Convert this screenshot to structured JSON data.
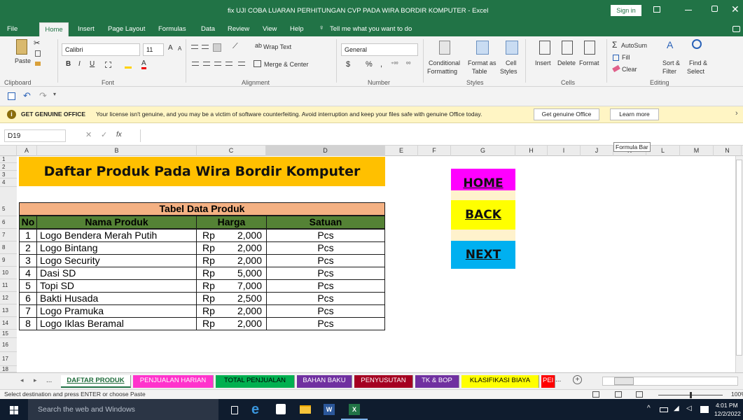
{
  "window": {
    "title": "fix UJI COBA LUARAN PERHITUNGAN CVP PADA WIRA BORDIR KOMPUTER  -  Excel",
    "sign_in": "Sign in"
  },
  "ribbon_tabs": [
    "File",
    "Home",
    "Insert",
    "Page Layout",
    "Formulas",
    "Data",
    "Review",
    "View",
    "Help"
  ],
  "tell_me": "Tell me what you want to do",
  "ribbon": {
    "clipboard": {
      "paste": "Paste",
      "label": "Clipboard"
    },
    "font": {
      "name": "Calibri",
      "size": "11",
      "label": "Font"
    },
    "alignment": {
      "wrap": "Wrap Text",
      "merge": "Merge & Center",
      "label": "Alignment"
    },
    "number": {
      "format": "General",
      "currency": "$",
      "percent": "%",
      "comma": ",",
      "label": "Number"
    },
    "styles": {
      "conditional": "Conditional",
      "conditional2": "Formatting",
      "format_as": "Format as",
      "format_as2": "Table",
      "cell": "Cell",
      "cell2": "Styles",
      "label": "Styles"
    },
    "cells": {
      "insert": "Insert",
      "delete": "Delete",
      "format": "Format",
      "label": "Cells"
    },
    "editing": {
      "autosum": "AutoSum",
      "fill": "Fill",
      "clear": "Clear",
      "sort": "Sort &",
      "sort2": "Filter",
      "find": "Find &",
      "find2": "Select",
      "label": "Editing"
    }
  },
  "message_bar": {
    "bold": "GET GENUINE OFFICE",
    "text": "Your license isn't genuine, and you may be a victim of software counterfeiting. Avoid interruption and keep your files safe with genuine Office today.",
    "btn1": "Get genuine Office",
    "btn2": "Learn more"
  },
  "formula_bar": {
    "name_box": "D19",
    "fx": "fx",
    "value": "",
    "tooltip": "Formula Bar"
  },
  "columns": [
    "A",
    "B",
    "C",
    "D",
    "E",
    "F",
    "G",
    "H",
    "I",
    "J",
    "K",
    "L",
    "M",
    "N"
  ],
  "rows": [
    "1",
    "2",
    "3",
    "4",
    "5",
    "6",
    "7",
    "8",
    "9",
    "10",
    "11",
    "12",
    "13",
    "14",
    "15",
    "16",
    "17",
    "18"
  ],
  "sheet": {
    "banner": "Daftar Produk Pada Wira Bordir Komputer",
    "table_title": "Tabel Data Produk",
    "headers": {
      "no": "No",
      "nama": "Nama Produk",
      "harga": "Harga",
      "satuan": "Satuan"
    },
    "products": [
      {
        "no": "1",
        "nama": "Logo Bendera Merah Putih",
        "rp": "Rp",
        "harga": "2,000",
        "satuan": "Pcs"
      },
      {
        "no": "2",
        "nama": "Logo Bintang",
        "rp": "Rp",
        "harga": "2,000",
        "satuan": "Pcs"
      },
      {
        "no": "3",
        "nama": "Logo Security",
        "rp": "Rp",
        "harga": "2,000",
        "satuan": "Pcs"
      },
      {
        "no": "4",
        "nama": "Dasi SD",
        "rp": "Rp",
        "harga": "5,000",
        "satuan": "Pcs"
      },
      {
        "no": "5",
        "nama": "Topi SD",
        "rp": "Rp",
        "harga": "7,000",
        "satuan": "Pcs"
      },
      {
        "no": "6",
        "nama": "Bakti Husada",
        "rp": "Rp",
        "harga": "2,500",
        "satuan": "Pcs"
      },
      {
        "no": "7",
        "nama": "Logo Pramuka",
        "rp": "Rp",
        "harga": "2,000",
        "satuan": "Pcs"
      },
      {
        "no": "8",
        "nama": "Logo Iklas Beramal",
        "rp": "Rp",
        "harga": "2,000",
        "satuan": "Pcs"
      }
    ],
    "nav_buttons": {
      "home": "HOME",
      "back": "BACK",
      "next": "NEXT"
    }
  },
  "sheet_tabs": [
    {
      "label": "DAFTAR PRODUK",
      "bg": "#ffffff",
      "fg": "#000000"
    },
    {
      "label": "PENJUALAN HARIAN",
      "bg": "#ff33cc",
      "fg": "#ffffff"
    },
    {
      "label": "TOTAL PENJUALAN",
      "bg": "#00b050",
      "fg": "#000000"
    },
    {
      "label": "BAHAN BAKU",
      "bg": "#7030a0",
      "fg": "#ffffff"
    },
    {
      "label": "PENYUSUTAN",
      "bg": "#a50021",
      "fg": "#ffffff"
    },
    {
      "label": "TK & BOP",
      "bg": "#7030a0",
      "fg": "#ffffff"
    },
    {
      "label": "KLASIFIKASI  BIAYA",
      "bg": "#ffff00",
      "fg": "#000000"
    },
    {
      "label": "PEI",
      "bg": "#ff0000",
      "fg": "#ffffff"
    }
  ],
  "tab_more": "...",
  "tab_ellipsis": "...",
  "status": {
    "text": "Select destination and press ENTER or choose Paste",
    "zoom": "100%"
  },
  "taskbar": {
    "search": "Search the web and Windows",
    "time": "4:01 PM",
    "date": "12/2/2022"
  },
  "colors": {
    "excel_green": "#217346",
    "banner": "#ffc000",
    "table_title": "#f4b183",
    "header_green": "#548235",
    "home": "#ff00ff",
    "back": "#ffff00",
    "next": "#00b0f0"
  }
}
